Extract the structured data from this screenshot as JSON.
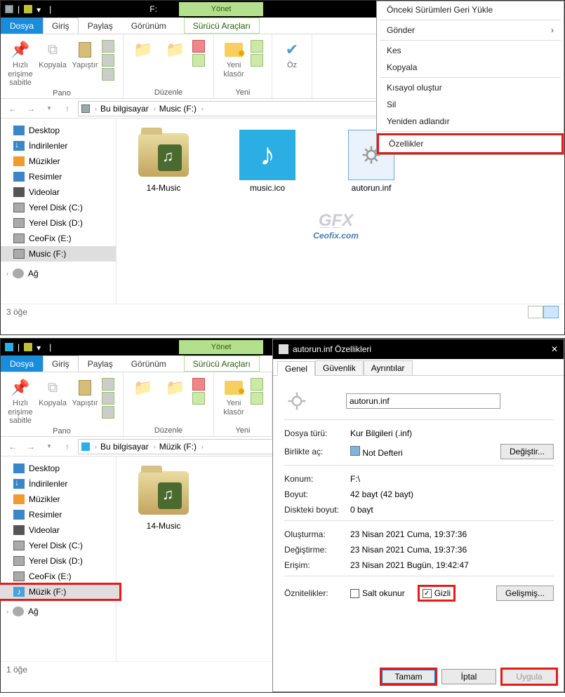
{
  "titlebar": {
    "manage": "Yönet",
    "drive_letter": "F:"
  },
  "tabs": {
    "file": "Dosya",
    "home": "Giriş",
    "share": "Paylaş",
    "view": "Görünüm",
    "drive_tools": "Sürücü Araçları"
  },
  "ribbon": {
    "pin": "Hızlı erişime\nsabitle",
    "copy": "Kopyala",
    "paste": "Yapıştır",
    "new_folder": "Yeni\nklasör",
    "properties_short": "Öz",
    "group_clipboard": "Pano",
    "group_organize": "Düzenle",
    "group_new": "Yeni"
  },
  "breadcrumb": {
    "this_pc": "Bu bilgisayar",
    "music_f": "Music (F:)",
    "music_f_lower": "Müzik (F:)"
  },
  "tree": {
    "desktop": "Desktop",
    "downloads": "İndirilenler",
    "music": "Müzikler",
    "pictures": "Resimler",
    "videos": "Videolar",
    "diskc": "Yerel Disk (C:)",
    "diskd": "Yerel Disk (D:)",
    "ceofixe": "CeoFix (E:)",
    "musicf": "Music (F:)",
    "musicf2": "Müzik (F:)",
    "network": "Ağ"
  },
  "files": {
    "folder": "14-Music",
    "ico": "music.ico",
    "inf": "autorun.inf"
  },
  "status": {
    "count1": "3 öğe",
    "count2": "1 öğe"
  },
  "watermark": "Ceofix.com",
  "context_menu": {
    "restore": "Önceki Sürümleri Geri Yükle",
    "send_to": "Gönder",
    "cut": "Kes",
    "copy": "Kopyala",
    "shortcut": "Kısayol oluştur",
    "delete": "Sil",
    "rename": "Yeniden adlandır",
    "properties": "Özellikler"
  },
  "properties": {
    "title": "autorun.inf Özellikleri",
    "tab_general": "Genel",
    "tab_security": "Güvenlik",
    "tab_details": "Ayrıntılar",
    "filename": "autorun.inf",
    "type_label": "Dosya türü:",
    "type_val": "Kur Bilgileri (.inf)",
    "opens_label": "Birlikte aç:",
    "opens_val": "Not Defteri",
    "change_btn": "Değiştir...",
    "location_label": "Konum:",
    "location_val": "F:\\",
    "size_label": "Boyut:",
    "size_val": "42 bayt (42 bayt)",
    "disksize_label": "Diskteki boyut:",
    "disksize_val": "0 bayt",
    "created_label": "Oluşturma:",
    "created_val": "23 Nisan 2021 Cuma, 19:37:36",
    "modified_label": "Değiştirme:",
    "modified_val": "23 Nisan 2021 Cuma, 19:37:36",
    "accessed_label": "Erişim:",
    "accessed_val": "23 Nisan 2021 Bugün, 19:42:47",
    "attr_label": "Öznitelikler:",
    "readonly": "Salt okunur",
    "hidden": "Gizli",
    "advanced": "Gelişmiş...",
    "ok": "Tamam",
    "cancel": "İptal",
    "apply": "Uygula"
  }
}
